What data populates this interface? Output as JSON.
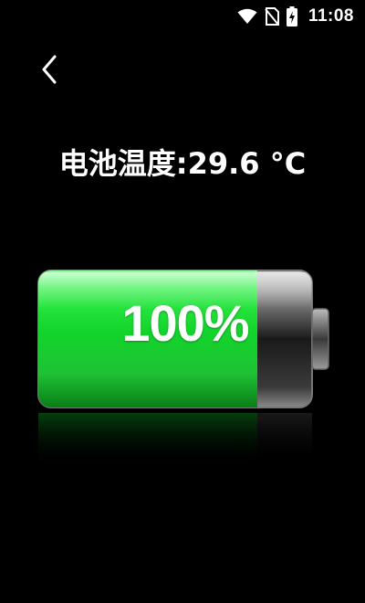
{
  "status_bar": {
    "time": "11:08",
    "icons": [
      "wifi-icon",
      "no-sim-icon",
      "battery-charging-icon"
    ]
  },
  "navigation": {
    "back_icon": "chevron-left-icon"
  },
  "temperature": {
    "label": "电池温度:",
    "value": "29.6",
    "unit": "°C"
  },
  "battery": {
    "percent_text": "100%",
    "level": 1.0,
    "fill_color": "#22e03a",
    "fill_dark": "#0a8a1a"
  }
}
